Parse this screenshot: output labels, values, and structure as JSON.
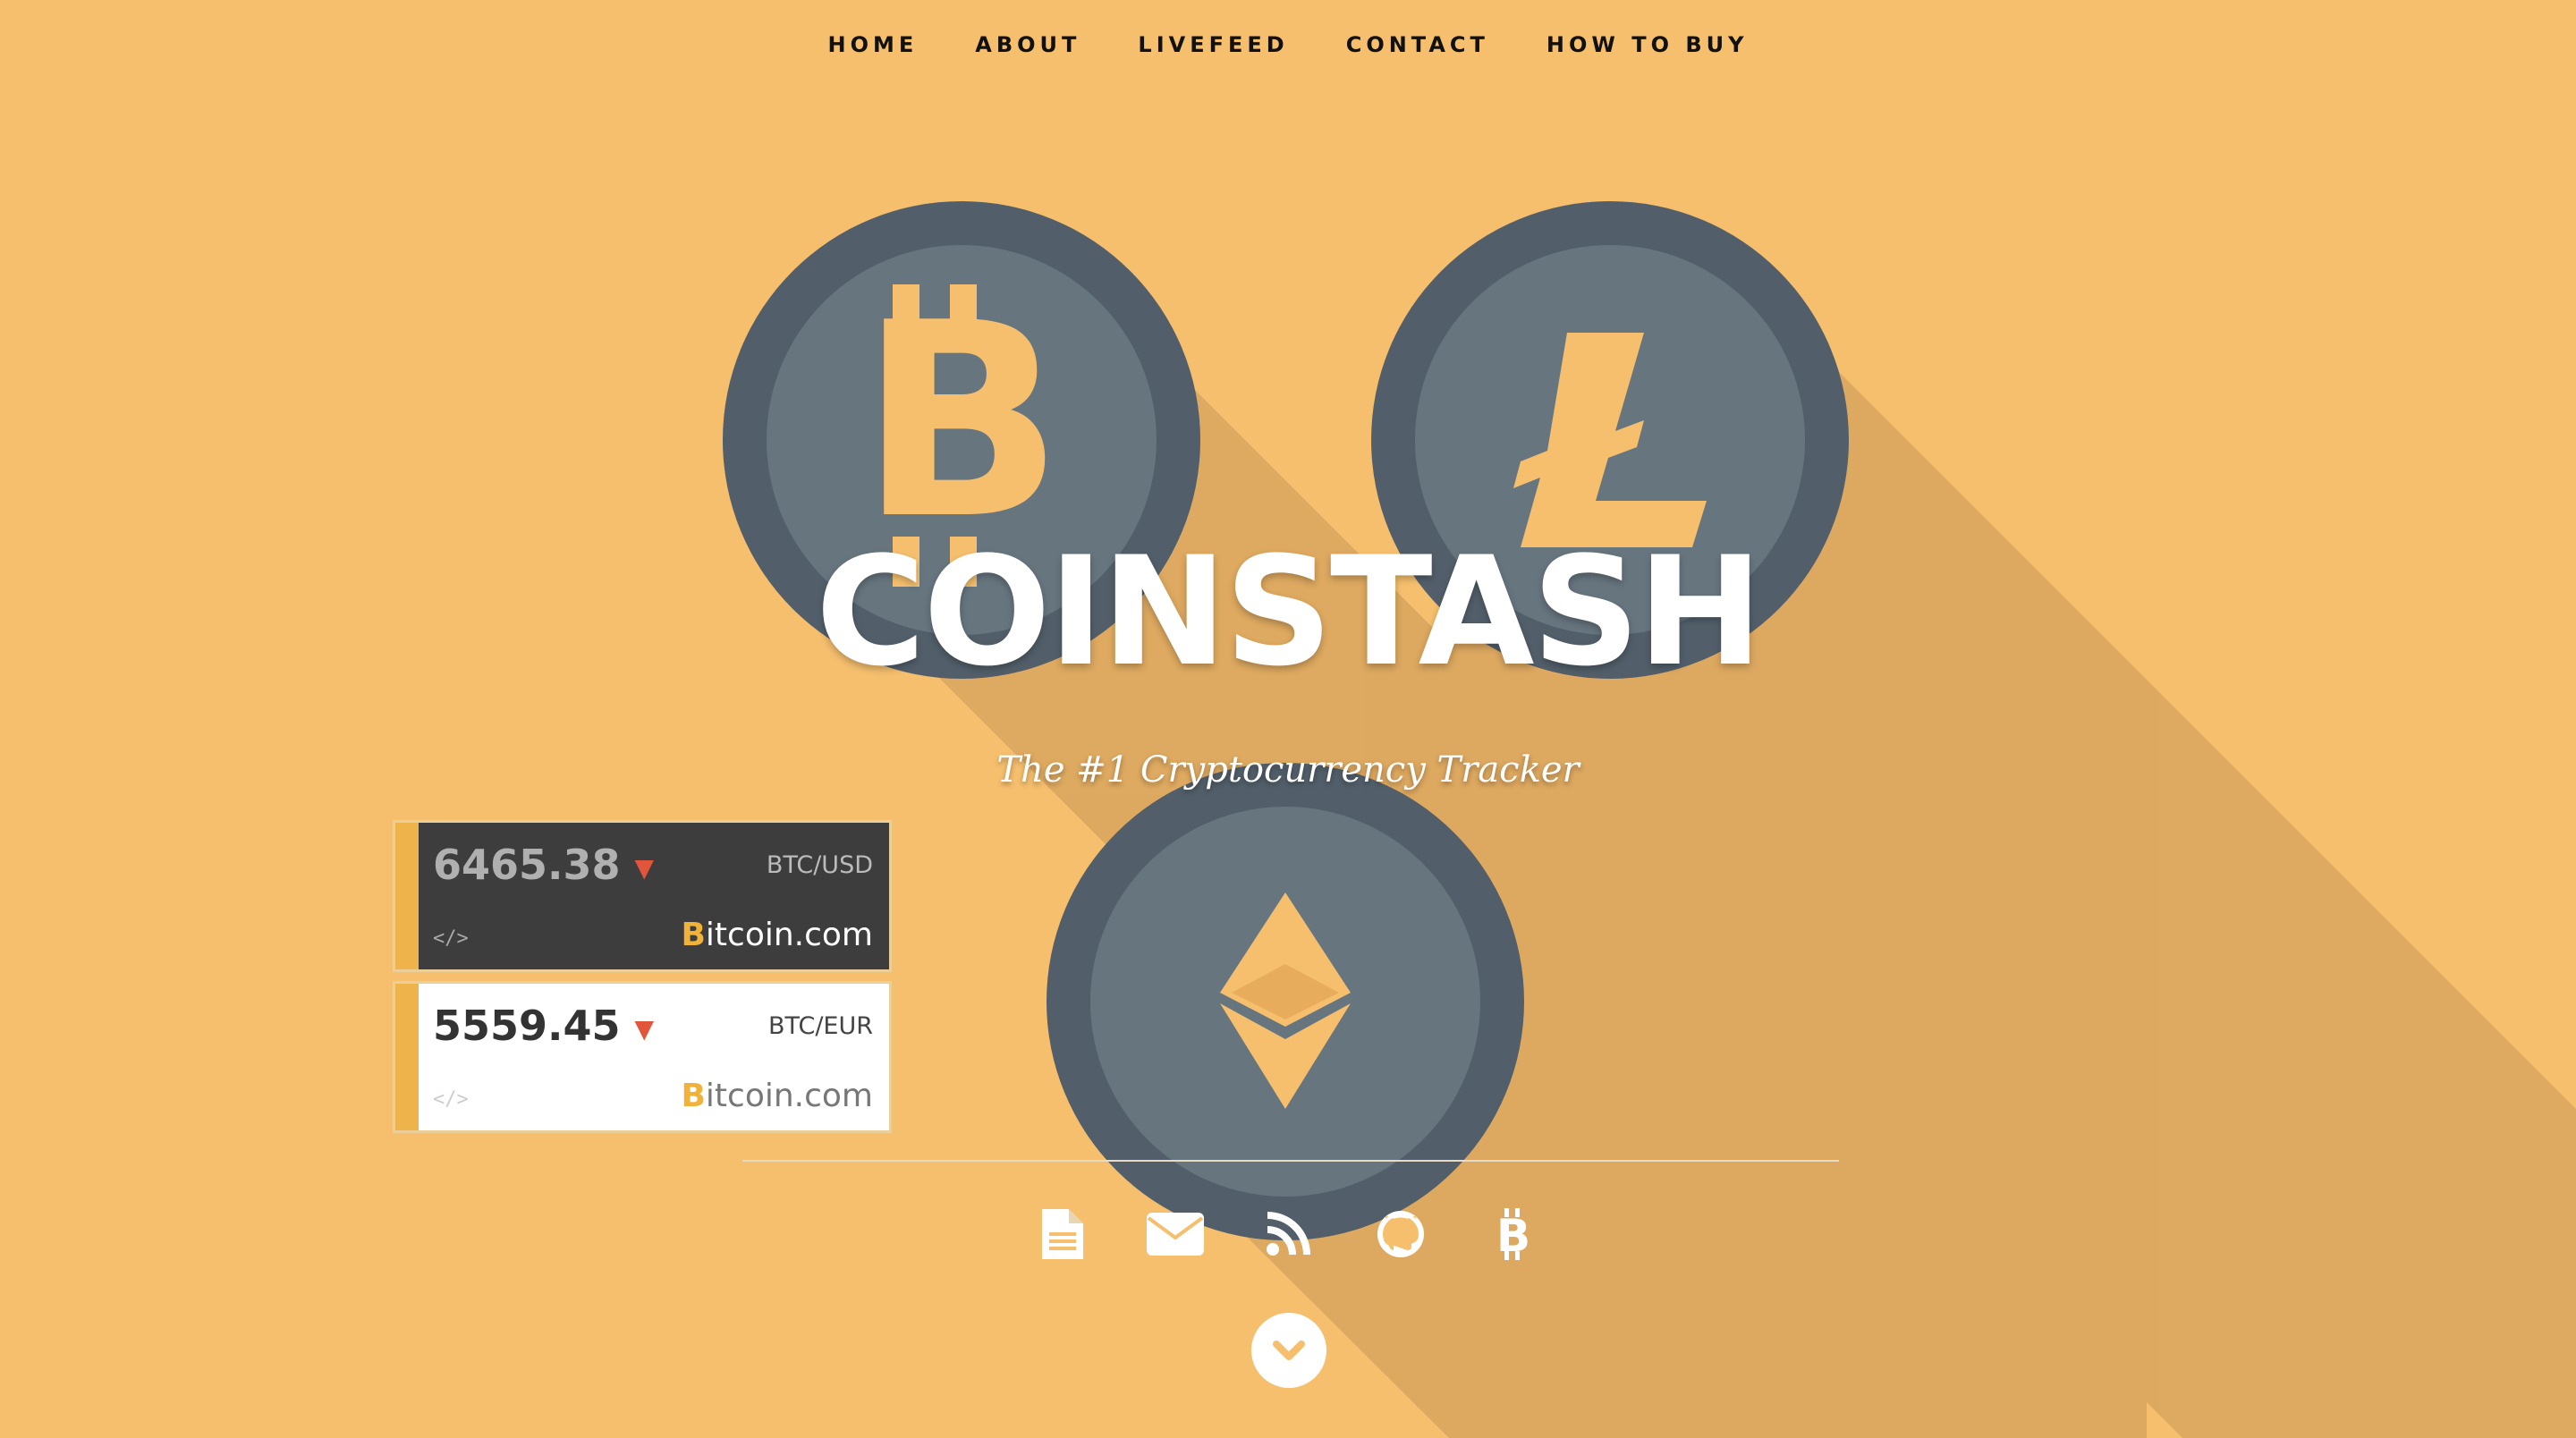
{
  "nav": {
    "items": [
      "HOME",
      "ABOUT",
      "LIVEFEED",
      "CONTACT",
      "HOW TO BUY"
    ]
  },
  "hero": {
    "title": "COINSTASH",
    "subtitle": "The #1 Cryptocurrency Tracker"
  },
  "widgets": [
    {
      "price": "6465.38",
      "pair": "BTC/USD",
      "code": "</>",
      "brand_b": "B",
      "brand_rest": "itcoin.com",
      "trend": "down"
    },
    {
      "price": "5559.45",
      "pair": "BTC/EUR",
      "code": "</>",
      "brand_b": "B",
      "brand_rest": "itcoin.com",
      "trend": "down"
    }
  ],
  "social": [
    "document-icon",
    "envelope-icon",
    "rss-icon",
    "github-icon",
    "bitcoin-icon"
  ],
  "colors": {
    "background": "#f5bf6e",
    "coin_outer": "#525f6a",
    "coin_inner": "#67757f",
    "coin_symbol": "#f5bf6e",
    "shadow": "#d9a55e",
    "accent_bar": "#efb34c",
    "down_arrow": "#e0553b"
  }
}
